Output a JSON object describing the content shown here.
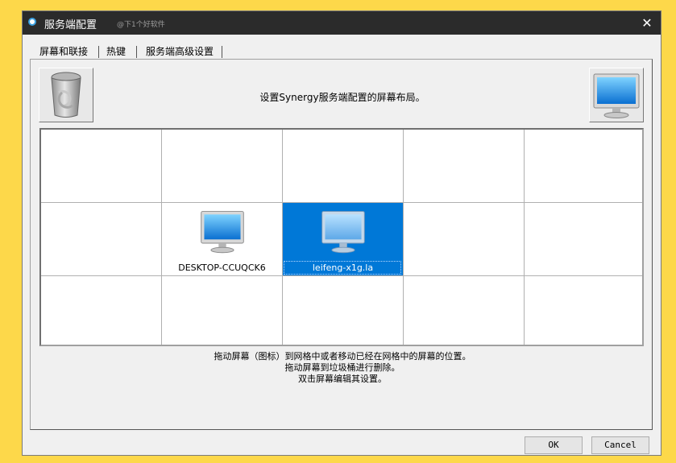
{
  "window": {
    "title": "服务端配置",
    "watermark": "@下1个好软件",
    "close_glyph": "✕"
  },
  "tabs": [
    {
      "label": "屏幕和联接",
      "active": true
    },
    {
      "label": "热键",
      "active": false
    },
    {
      "label": "服务端高级设置",
      "active": false
    }
  ],
  "layout": {
    "instruction": "设置Synergy服务端配置的屏幕布局。",
    "trash_icon": "trash-can-icon",
    "new_screen_icon": "monitor-icon",
    "grid_rows": 3,
    "grid_cols": 5,
    "screens": [
      {
        "name": "DESKTOP-CCUQCK6",
        "row": 1,
        "col": 1,
        "selected": false
      },
      {
        "name": "leifeng-x1g.la",
        "row": 1,
        "col": 2,
        "selected": true
      }
    ],
    "help_lines": [
      "拖动屏幕（图标）到网格中或者移动已经在网格中的屏幕的位置。",
      "拖动屏幕到垃圾桶进行删除。",
      "双击屏幕编辑其设置。"
    ]
  },
  "buttons": {
    "ok": "OK",
    "cancel": "Cancel"
  },
  "colors": {
    "selection": "#0078d7",
    "titlebar": "#2b2b2b",
    "background": "#fdd84a"
  }
}
